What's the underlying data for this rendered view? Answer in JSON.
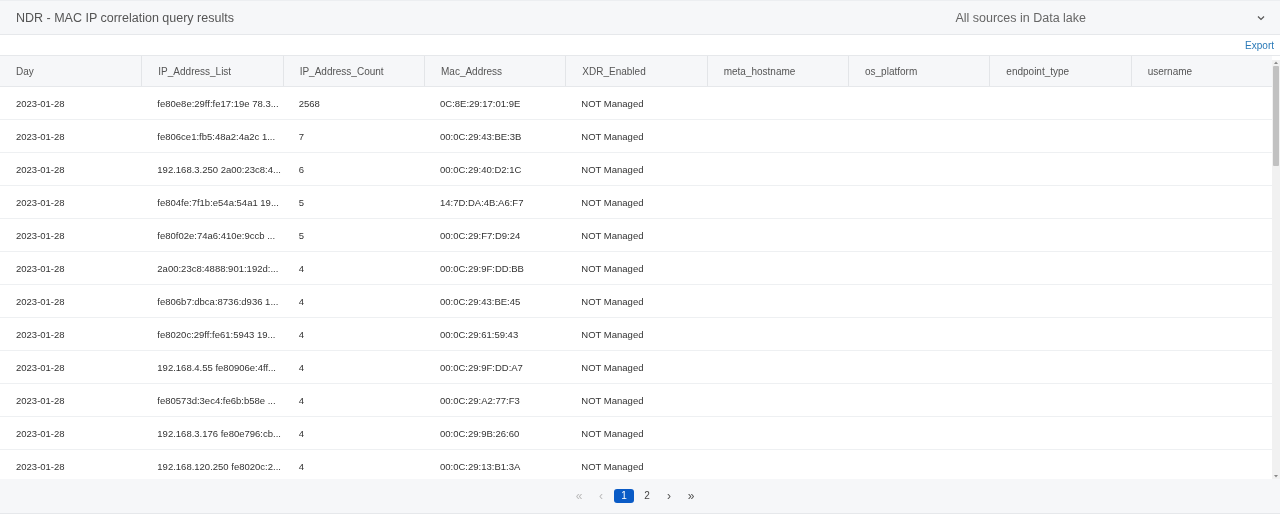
{
  "header": {
    "title": "NDR - MAC IP correlation query results",
    "source": "All sources in Data lake"
  },
  "toolbar": {
    "export": "Export"
  },
  "table": {
    "columns": [
      "Day",
      "IP_Address_List",
      "IP_Address_Count",
      "Mac_Address",
      "XDR_Enabled",
      "meta_hostname",
      "os_platform",
      "endpoint_type",
      "username"
    ],
    "rows": [
      [
        "2023-01-28",
        "fe80e8e:29ff:fe17:19e 78.3...",
        "2568",
        "0C:8E:29:17:01:9E",
        "NOT Managed"
      ],
      [
        "2023-01-28",
        "fe806ce1:fb5:48a2:4a2c 1...",
        "7",
        "00:0C:29:43:BE:3B",
        "NOT Managed"
      ],
      [
        "2023-01-28",
        "192.168.3.250 2a00:23c8:4...",
        "6",
        "00:0C:29:40:D2:1C",
        "NOT Managed"
      ],
      [
        "2023-01-28",
        "fe804fe:7f1b:e54a:54a1 19...",
        "5",
        "14:7D:DA:4B:A6:F7",
        "NOT Managed"
      ],
      [
        "2023-01-28",
        "fe80f02e:74a6:410e:9ccb ...",
        "5",
        "00:0C:29:F7:D9:24",
        "NOT Managed"
      ],
      [
        "2023-01-28",
        "2a00:23c8:4888:901:192d:...",
        "4",
        "00:0C:29:9F:DD:BB",
        "NOT Managed"
      ],
      [
        "2023-01-28",
        "fe806b7:dbca:8736:d936 1...",
        "4",
        "00:0C:29:43:BE:45",
        "NOT Managed"
      ],
      [
        "2023-01-28",
        "fe8020c:29ff:fe61:5943 19...",
        "4",
        "00:0C:29:61:59:43",
        "NOT Managed"
      ],
      [
        "2023-01-28",
        "192.168.4.55 fe80906e:4ff...",
        "4",
        "00:0C:29:9F:DD:A7",
        "NOT Managed"
      ],
      [
        "2023-01-28",
        "fe80573d:3ec4:fe6b:b58e ...",
        "4",
        "00:0C:29:A2:77:F3",
        "NOT Managed"
      ],
      [
        "2023-01-28",
        "192.168.3.176 fe80e796:cb...",
        "4",
        "00:0C:29:9B:26:60",
        "NOT Managed"
      ],
      [
        "2023-01-28",
        "192.168.120.250 fe8020c:2...",
        "4",
        "00:0C:29:13:B1:3A",
        "NOT Managed"
      ]
    ]
  },
  "pagination": [
    {
      "kind": "nav",
      "label": "«",
      "disabled": true,
      "selected": false
    },
    {
      "kind": "nav",
      "label": "‹",
      "disabled": true,
      "selected": false
    },
    {
      "kind": "page",
      "label": "1",
      "disabled": false,
      "selected": true
    },
    {
      "kind": "page",
      "label": "2",
      "disabled": false,
      "selected": false
    },
    {
      "kind": "nav",
      "label": "›",
      "disabled": false,
      "selected": false
    },
    {
      "kind": "nav",
      "label": "»",
      "disabled": false,
      "selected": false
    }
  ]
}
